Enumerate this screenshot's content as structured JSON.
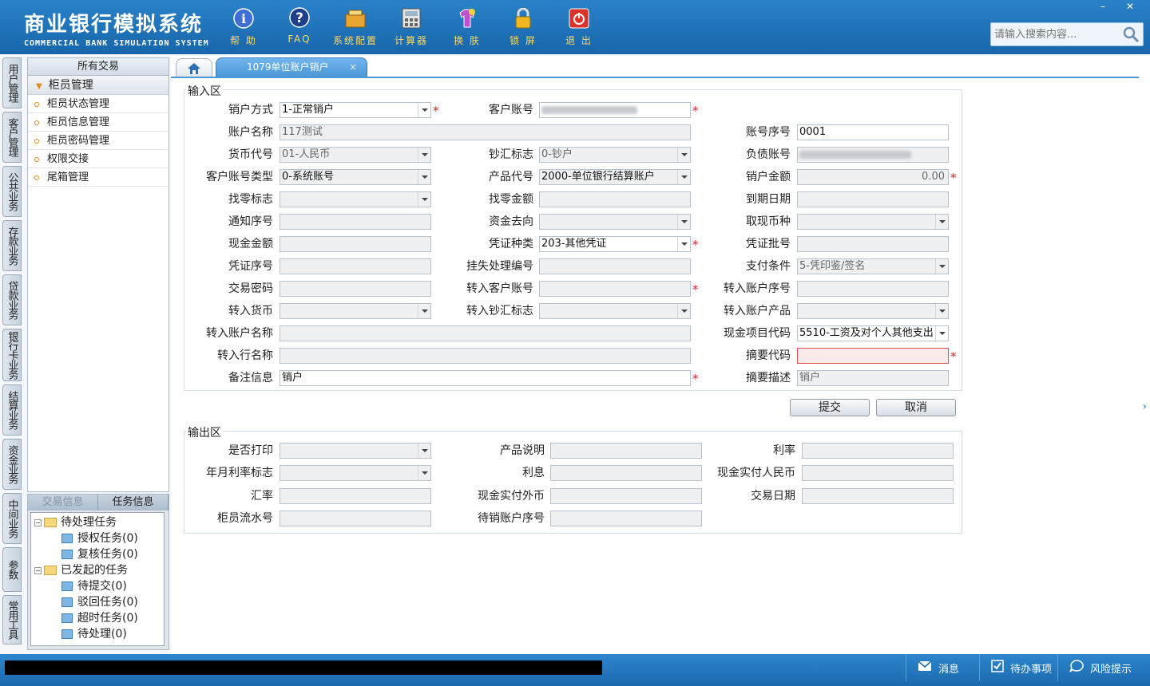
{
  "header": {
    "title": "商业银行模拟系统",
    "subtitle": "COMMERCIAL BANK SIMULATION SYSTEM",
    "tools": [
      {
        "label": "帮 助",
        "icon": "help-icon"
      },
      {
        "label": "FAQ",
        "icon": "faq-icon"
      },
      {
        "label": "系统配置",
        "icon": "settings-icon"
      },
      {
        "label": "计算器",
        "icon": "calculator-icon"
      },
      {
        "label": "换 肤",
        "icon": "skin-icon"
      },
      {
        "label": "锁 屏",
        "icon": "lock-icon"
      },
      {
        "label": "退 出",
        "icon": "power-icon"
      }
    ],
    "search_placeholder": "请输入搜索内容...",
    "win_min": "–",
    "win_close": "✕"
  },
  "vtabs": [
    "用户管理",
    "客户管理",
    "公共业务",
    "存款业务",
    "贷款业务",
    "银行卡业务",
    "结算业务",
    "资金业务",
    "中间业务",
    "参数",
    "常用工具"
  ],
  "left_panel": {
    "header": "所有交易",
    "group": "柜员管理",
    "items": [
      "柜员状态管理",
      "柜员信息管理",
      "柜员密码管理",
      "权限交接",
      "尾箱管理"
    ]
  },
  "task_panel": {
    "tabs": [
      "交易信息",
      "任务信息"
    ],
    "tree": [
      {
        "label": "待处理任务",
        "level": 0
      },
      {
        "label": "授权任务(0)",
        "level": 1
      },
      {
        "label": "复核任务(0)",
        "level": 1
      },
      {
        "label": "已发起的任务",
        "level": 0
      },
      {
        "label": "待提交(0)",
        "level": 1
      },
      {
        "label": "驳回任务(0)",
        "level": 1
      },
      {
        "label": "超时任务(0)",
        "level": 1
      },
      {
        "label": "待处理(0)",
        "level": 1
      }
    ]
  },
  "tabs": {
    "active": "1079单位账户销户",
    "close": "×"
  },
  "input_section": {
    "title": "输入区",
    "fields": {
      "xiaohu_fangshi": {
        "label": "销户方式",
        "value": "1-正常销户"
      },
      "kehu_zhanghao": {
        "label": "客户账号",
        "value": ""
      },
      "zhanghu_mingcheng": {
        "label": "账户名称",
        "value": "117测试"
      },
      "zhanghao_xuhao": {
        "label": "账号序号",
        "value": "0001"
      },
      "huobi_daihao": {
        "label": "货币代号",
        "value": "01-人民币"
      },
      "chaohui_biaozhi": {
        "label": "钞汇标志",
        "value": "0-钞户"
      },
      "fuzhai_zhanghao": {
        "label": "负债账号",
        "value": ""
      },
      "kehu_zhanghao_leixing": {
        "label": "客户账号类型",
        "value": "0-系统账号"
      },
      "chanpin_daihao": {
        "label": "产品代号",
        "value": "2000-单位银行结算账户"
      },
      "xiaohu_jine": {
        "label": "销户金额",
        "value": "0.00"
      },
      "zhaoling_biaozhi": {
        "label": "找零标志",
        "value": ""
      },
      "zhaoling_jine": {
        "label": "找零金额",
        "value": ""
      },
      "daoqi_riqi": {
        "label": "到期日期",
        "value": ""
      },
      "tongzhi_xuhao": {
        "label": "通知序号",
        "value": ""
      },
      "zijin_quxiang": {
        "label": "资金去向",
        "value": ""
      },
      "quxian_bizhong": {
        "label": "取现币种",
        "value": ""
      },
      "xianjin_jine": {
        "label": "现金金额",
        "value": ""
      },
      "pingzheng_zhonglei": {
        "label": "凭证种类",
        "value": "203-其他凭证"
      },
      "pingzheng_pihao": {
        "label": "凭证批号",
        "value": ""
      },
      "pingzheng_xuhao": {
        "label": "凭证序号",
        "value": ""
      },
      "guashi_chuli_bianhao": {
        "label": "挂失处理编号",
        "value": ""
      },
      "zhifu_tiaojian": {
        "label": "支付条件",
        "value": "5-凭印鉴/签名"
      },
      "jiaoyi_mima": {
        "label": "交易密码",
        "value": ""
      },
      "zhuanru_kehu_zhanghao": {
        "label": "转入客户账号",
        "value": ""
      },
      "zhuanru_zhanghu_xuhao": {
        "label": "转入账户序号",
        "value": ""
      },
      "zhuanru_huobi": {
        "label": "转入货币",
        "value": ""
      },
      "zhuanru_chaohui_biaozhi": {
        "label": "转入钞汇标志",
        "value": ""
      },
      "zhuanru_zhanghu_chanpin": {
        "label": "转入账户产品",
        "value": ""
      },
      "zhuanru_zhanghu_mingcheng": {
        "label": "转入账户名称",
        "value": ""
      },
      "xianjin_xiangmu_daima": {
        "label": "现金项目代码",
        "value": "5510-工资及对个人其他支出"
      },
      "zhuanru_hang_mingcheng": {
        "label": "转入行名称",
        "value": ""
      },
      "zhaiyao_daima": {
        "label": "摘要代码",
        "value": ""
      },
      "beizhu_xinxi": {
        "label": "备注信息",
        "value": "销户"
      },
      "zhaiyao_miaoshu": {
        "label": "摘要描述",
        "value": "销户"
      }
    },
    "required_mark": "*"
  },
  "buttons": {
    "submit": "提交",
    "cancel": "取消"
  },
  "output_section": {
    "title": "输出区",
    "fields": {
      "shifou_dayin": {
        "label": "是否打印",
        "value": ""
      },
      "chanpin_shuoming": {
        "label": "产品说明",
        "value": ""
      },
      "lilv": {
        "label": "利率",
        "value": ""
      },
      "nianyue_lilv_biaozhi": {
        "label": "年月利率标志",
        "value": ""
      },
      "lixi": {
        "label": "利息",
        "value": ""
      },
      "xianjin_shifu_rmb": {
        "label": "现金实付人民币",
        "value": ""
      },
      "huilv": {
        "label": "汇率",
        "value": ""
      },
      "xianjin_shifu_waibi": {
        "label": "现金实付外币",
        "value": ""
      },
      "jiaoyi_riqi": {
        "label": "交易日期",
        "value": ""
      },
      "guiyuan_liushuihao": {
        "label": "柜员流水号",
        "value": ""
      },
      "daixiao_zhanghu_xuhao": {
        "label": "待销账户序号",
        "value": ""
      }
    }
  },
  "status": {
    "messages": "消息",
    "todo": "待办事项",
    "risk": "风险提示"
  },
  "side_arrow": "›"
}
